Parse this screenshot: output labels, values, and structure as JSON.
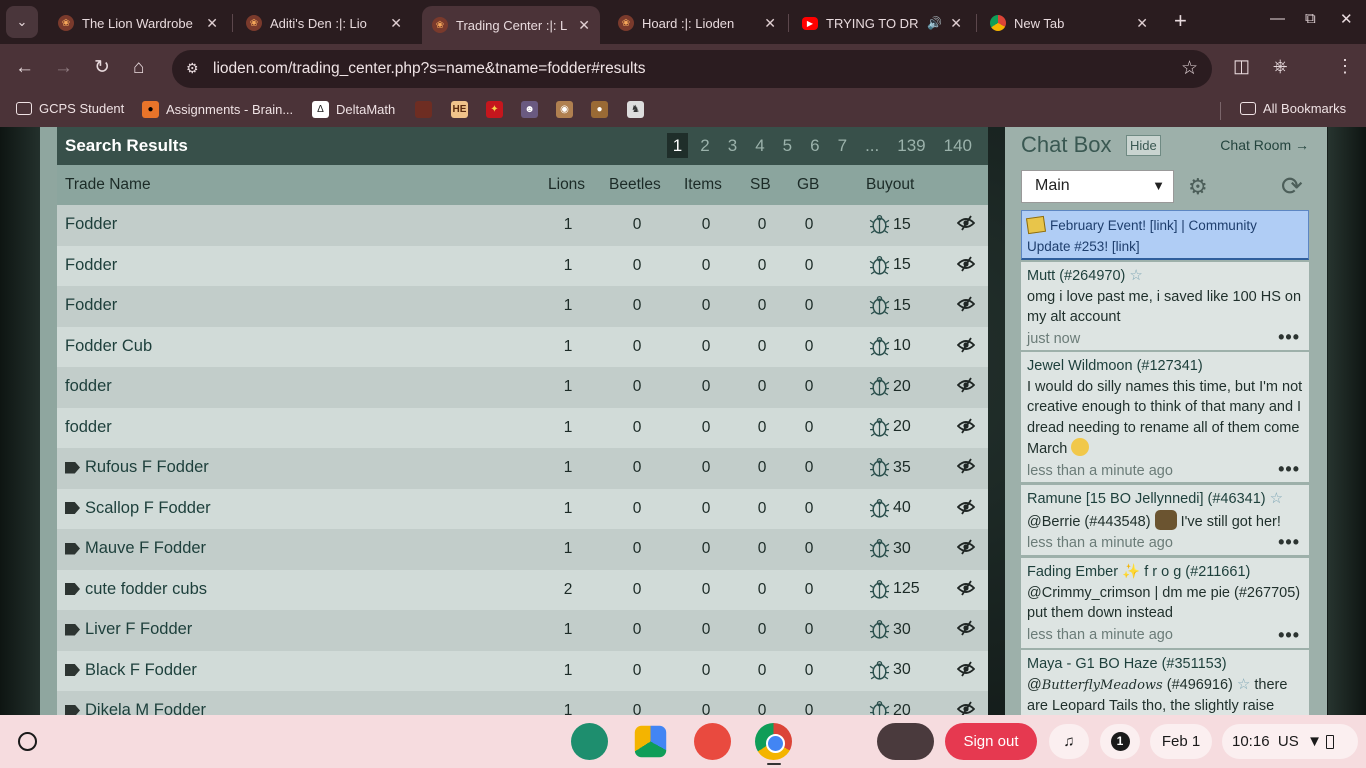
{
  "browser": {
    "tabs": [
      {
        "title": "The Lion Wardrobe",
        "icon": "lioden-paw-icon",
        "active": false
      },
      {
        "title": "Aditi's Den :|: Lio",
        "icon": "lioden-paw-icon",
        "active": false
      },
      {
        "title": "Trading Center :|: L",
        "icon": "lioden-paw-icon",
        "active": true
      },
      {
        "title": "Hoard :|: Lioden",
        "icon": "lioden-paw-icon",
        "active": false
      },
      {
        "title": "TRYING TO DR",
        "icon": "youtube-icon",
        "active": false
      },
      {
        "title": "New Tab",
        "icon": "chrome-icon",
        "active": false
      }
    ],
    "url": "lioden.com/trading_center.php?s=name&tname=fodder#results",
    "bookmarks": [
      {
        "label": "GCPS Student",
        "icon": "folder-icon"
      },
      {
        "label": "Assignments - Brain...",
        "icon": "brainpop-icon"
      },
      {
        "label": "DeltaMath",
        "icon": "deltamath-icon"
      }
    ],
    "all_bookmarks": "All Bookmarks"
  },
  "results": {
    "title": "Search Results",
    "pages": [
      "1",
      "2",
      "3",
      "4",
      "5",
      "6",
      "7",
      "...",
      "139",
      "140"
    ],
    "current_page": "1",
    "columns": {
      "name": "Trade Name",
      "lions": "Lions",
      "beetles": "Beetles",
      "items": "Items",
      "sb": "SB",
      "gb": "GB",
      "buyout": "Buyout"
    },
    "rows": [
      {
        "name": "Fodder",
        "tag": false,
        "lions": "1",
        "beetles": "0",
        "items": "0",
        "sb": "0",
        "gb": "0",
        "buyout": "15"
      },
      {
        "name": "Fodder",
        "tag": false,
        "lions": "1",
        "beetles": "0",
        "items": "0",
        "sb": "0",
        "gb": "0",
        "buyout": "15"
      },
      {
        "name": "Fodder",
        "tag": false,
        "lions": "1",
        "beetles": "0",
        "items": "0",
        "sb": "0",
        "gb": "0",
        "buyout": "15"
      },
      {
        "name": "Fodder Cub",
        "tag": false,
        "lions": "1",
        "beetles": "0",
        "items": "0",
        "sb": "0",
        "gb": "0",
        "buyout": "10"
      },
      {
        "name": "fodder",
        "tag": false,
        "lions": "1",
        "beetles": "0",
        "items": "0",
        "sb": "0",
        "gb": "0",
        "buyout": "20"
      },
      {
        "name": "fodder",
        "tag": false,
        "lions": "1",
        "beetles": "0",
        "items": "0",
        "sb": "0",
        "gb": "0",
        "buyout": "20"
      },
      {
        "name": "Rufous F Fodder",
        "tag": true,
        "lions": "1",
        "beetles": "0",
        "items": "0",
        "sb": "0",
        "gb": "0",
        "buyout": "35"
      },
      {
        "name": "Scallop F Fodder",
        "tag": true,
        "lions": "1",
        "beetles": "0",
        "items": "0",
        "sb": "0",
        "gb": "0",
        "buyout": "40"
      },
      {
        "name": "Mauve F Fodder",
        "tag": true,
        "lions": "1",
        "beetles": "0",
        "items": "0",
        "sb": "0",
        "gb": "0",
        "buyout": "30"
      },
      {
        "name": "cute fodder cubs",
        "tag": true,
        "lions": "2",
        "beetles": "0",
        "items": "0",
        "sb": "0",
        "gb": "0",
        "buyout": "125"
      },
      {
        "name": "Liver F Fodder",
        "tag": true,
        "lions": "1",
        "beetles": "0",
        "items": "0",
        "sb": "0",
        "gb": "0",
        "buyout": "30"
      },
      {
        "name": "Black F Fodder",
        "tag": true,
        "lions": "1",
        "beetles": "0",
        "items": "0",
        "sb": "0",
        "gb": "0",
        "buyout": "30"
      },
      {
        "name": "Dikela M Fodder",
        "tag": true,
        "lions": "1",
        "beetles": "0",
        "items": "0",
        "sb": "0",
        "gb": "0",
        "buyout": "20"
      }
    ]
  },
  "chat": {
    "title": "Chat Box",
    "hide": "Hide",
    "room_link": "Chat Room →",
    "channel": "Main",
    "announcement": "February Event! [link] | Community Update #253! [link]",
    "messages": [
      {
        "author": "Mutt (#264970)",
        "text": "omg i love past me, i saved like 100 HS on my alt account",
        "time": "just now"
      },
      {
        "author": "Jewel Wildmoon (#127341)",
        "text": "I would do silly names this time, but I'm not creative enough to think of that many and I dread needing to rename all of them come March",
        "time": "less than a minute ago"
      },
      {
        "author": "Ramune [15 BO Jellynnedi] (#46341)",
        "text_a": "@Berrie (#443548)",
        "text_b": "I've still got her!",
        "time": "less than a minute ago"
      },
      {
        "author_a": "Fading Ember",
        "author_b": "f r o g (#211661)",
        "text": "@Crimmy_crimson | dm me pie (#267705) put them down instead",
        "time": "less than a minute ago"
      },
      {
        "author": "Maya - G1 BO Haze (#351153)",
        "text_a": "@",
        "script": "ButterflyMeadows",
        "text_b": "(#496916)",
        "text_c": "there are Leopard Tails tho, the slightly raise"
      }
    ]
  },
  "shelf": {
    "signout": "Sign out",
    "notifications": "1",
    "date": "Feb 1",
    "time": "10:16",
    "locale": "US"
  }
}
